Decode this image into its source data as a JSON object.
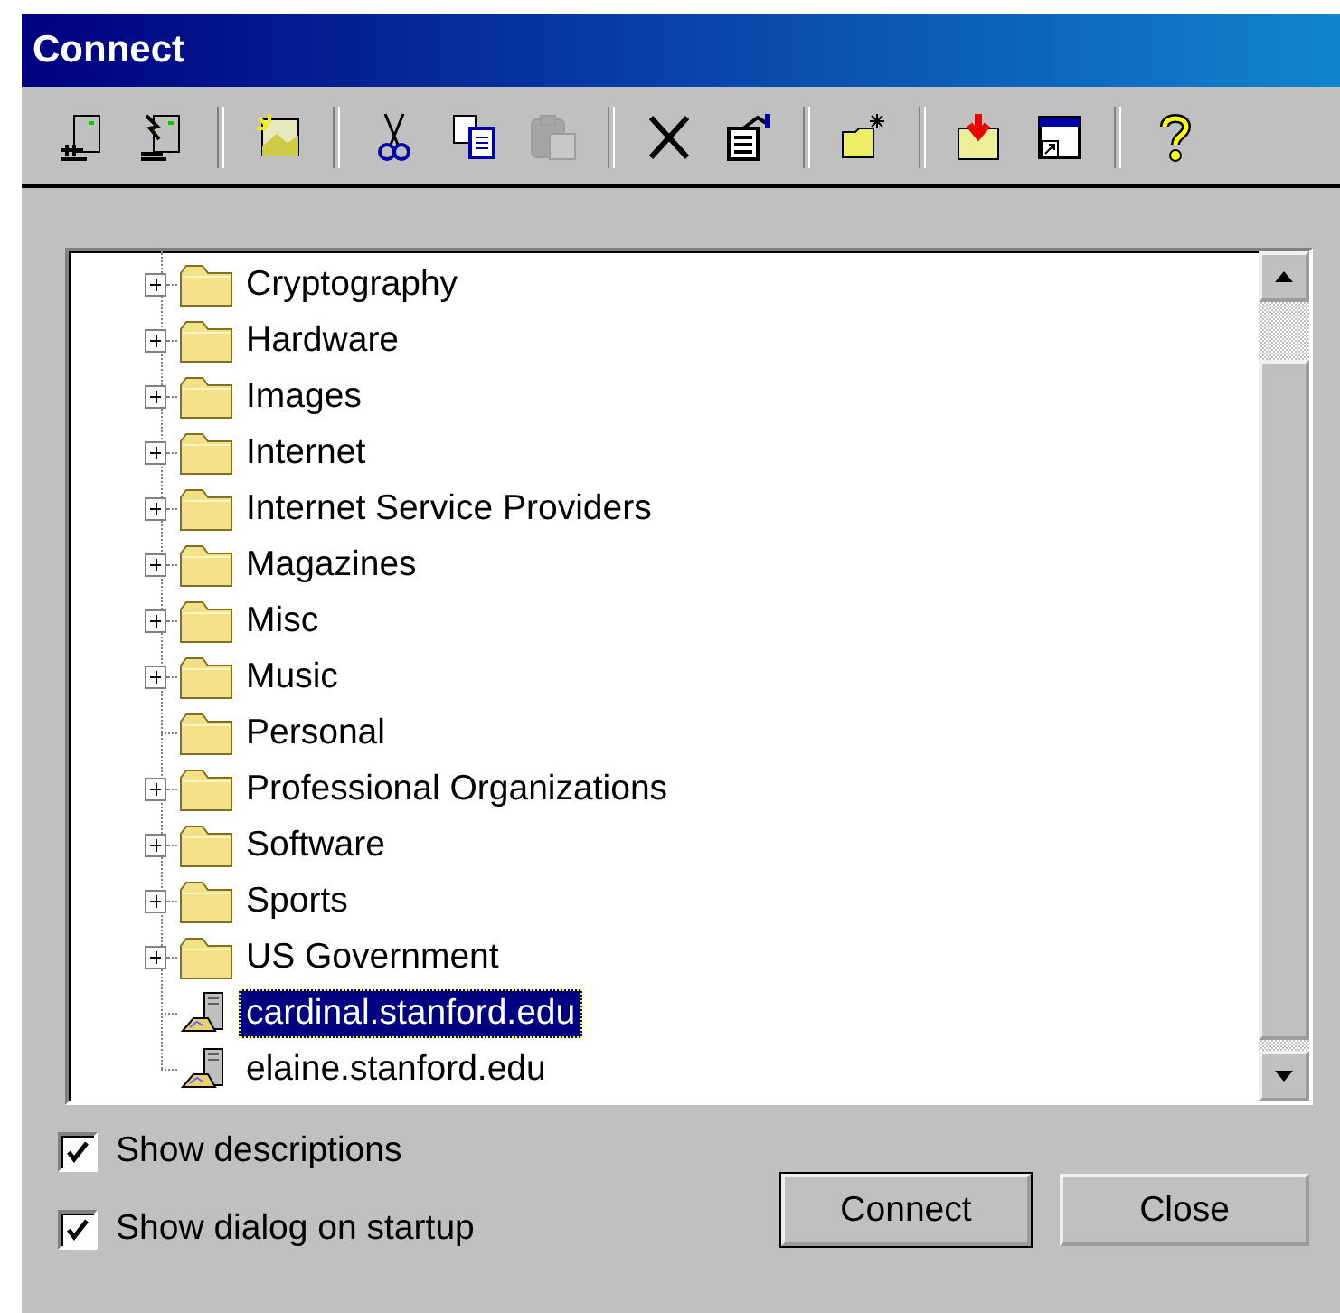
{
  "window": {
    "title": "Connect"
  },
  "toolbar": {
    "groups": [
      [
        {
          "disabled": false
        },
        {
          "disabled": false
        }
      ],
      [
        {
          "disabled": false
        }
      ],
      [
        {
          "disabled": false
        },
        {
          "disabled": false
        },
        {
          "disabled": true
        }
      ],
      [
        {
          "disabled": false
        },
        {
          "disabled": false
        }
      ],
      [
        {
          "disabled": false
        }
      ],
      [
        {
          "disabled": false
        },
        {
          "disabled": false
        }
      ],
      [
        {
          "disabled": false
        }
      ]
    ]
  },
  "tree": {
    "items": [
      {
        "kind": "folder",
        "label": "Cryptography",
        "expandable": true,
        "selected": false
      },
      {
        "kind": "folder",
        "label": "Hardware",
        "expandable": true,
        "selected": false
      },
      {
        "kind": "folder",
        "label": "Images",
        "expandable": true,
        "selected": false
      },
      {
        "kind": "folder",
        "label": "Internet",
        "expandable": true,
        "selected": false
      },
      {
        "kind": "folder",
        "label": "Internet Service Providers",
        "expandable": true,
        "selected": false
      },
      {
        "kind": "folder",
        "label": "Magazines",
        "expandable": true,
        "selected": false
      },
      {
        "kind": "folder",
        "label": "Misc",
        "expandable": true,
        "selected": false
      },
      {
        "kind": "folder",
        "label": "Music",
        "expandable": true,
        "selected": false
      },
      {
        "kind": "folder",
        "label": "Personal",
        "expandable": false,
        "selected": false
      },
      {
        "kind": "folder",
        "label": "Professional Organizations",
        "expandable": true,
        "selected": false
      },
      {
        "kind": "folder",
        "label": "Software",
        "expandable": true,
        "selected": false
      },
      {
        "kind": "folder",
        "label": "Sports",
        "expandable": true,
        "selected": false
      },
      {
        "kind": "folder",
        "label": "US Government",
        "expandable": true,
        "selected": false
      },
      {
        "kind": "host",
        "label": "cardinal.stanford.edu",
        "expandable": false,
        "selected": true
      },
      {
        "kind": "host",
        "label": "elaine.stanford.edu",
        "expandable": false,
        "selected": false
      }
    ]
  },
  "options": [
    {
      "label": "Show descriptions",
      "checked": true
    },
    {
      "label": "Show dialog on startup",
      "checked": true
    }
  ],
  "buttons": [
    {
      "label": "Connect",
      "default": true
    },
    {
      "label": "Close",
      "default": false
    }
  ]
}
